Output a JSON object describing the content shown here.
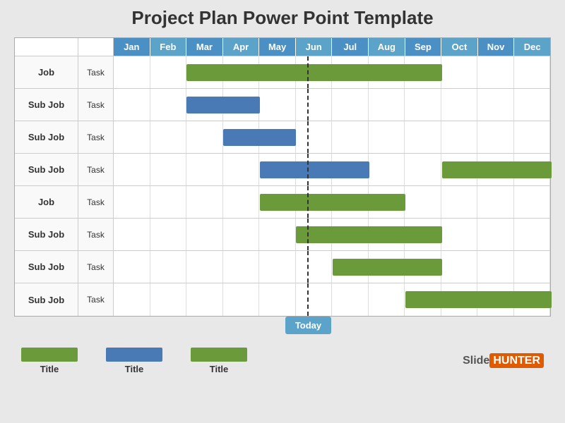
{
  "title": "Project Plan Power Point Template",
  "months": [
    "Jan",
    "Feb",
    "Mar",
    "Apr",
    "May",
    "Jun",
    "Jul",
    "Aug",
    "Sep",
    "Oct",
    "Nov",
    "Dec"
  ],
  "rows": [
    {
      "label": "Job",
      "task": "Task",
      "bars": [
        {
          "start": 2,
          "end": 9,
          "color": "green"
        }
      ]
    },
    {
      "label": "Sub Job",
      "task": "Task",
      "bars": [
        {
          "start": 2,
          "end": 4,
          "color": "blue"
        }
      ]
    },
    {
      "label": "Sub Job",
      "task": "Task",
      "bars": [
        {
          "start": 3,
          "end": 5,
          "color": "blue"
        }
      ]
    },
    {
      "label": "Sub Job",
      "task": "Task",
      "bars": [
        {
          "start": 4,
          "end": 7,
          "color": "blue"
        },
        {
          "start": 9,
          "end": 12,
          "color": "green"
        }
      ]
    },
    {
      "label": "Job",
      "task": "Task",
      "bars": [
        {
          "start": 4,
          "end": 8,
          "color": "green"
        }
      ]
    },
    {
      "label": "Sub Job",
      "task": "Task",
      "bars": [
        {
          "start": 5,
          "end": 9,
          "color": "green"
        }
      ]
    },
    {
      "label": "Sub Job",
      "task": "Task",
      "bars": [
        {
          "start": 6,
          "end": 9,
          "color": "green"
        }
      ]
    },
    {
      "label": "Sub Job",
      "task": "Task",
      "bars": [
        {
          "start": 8,
          "end": 12,
          "color": "green"
        }
      ]
    }
  ],
  "today_label": "Today",
  "today_col": 5.3,
  "legend": [
    {
      "color": "green",
      "label": "Title"
    },
    {
      "color": "blue",
      "label": "Title"
    },
    {
      "color": "green",
      "label": "Title"
    }
  ],
  "logo": {
    "slide": "Slide",
    "hunter": "HUNTER"
  }
}
